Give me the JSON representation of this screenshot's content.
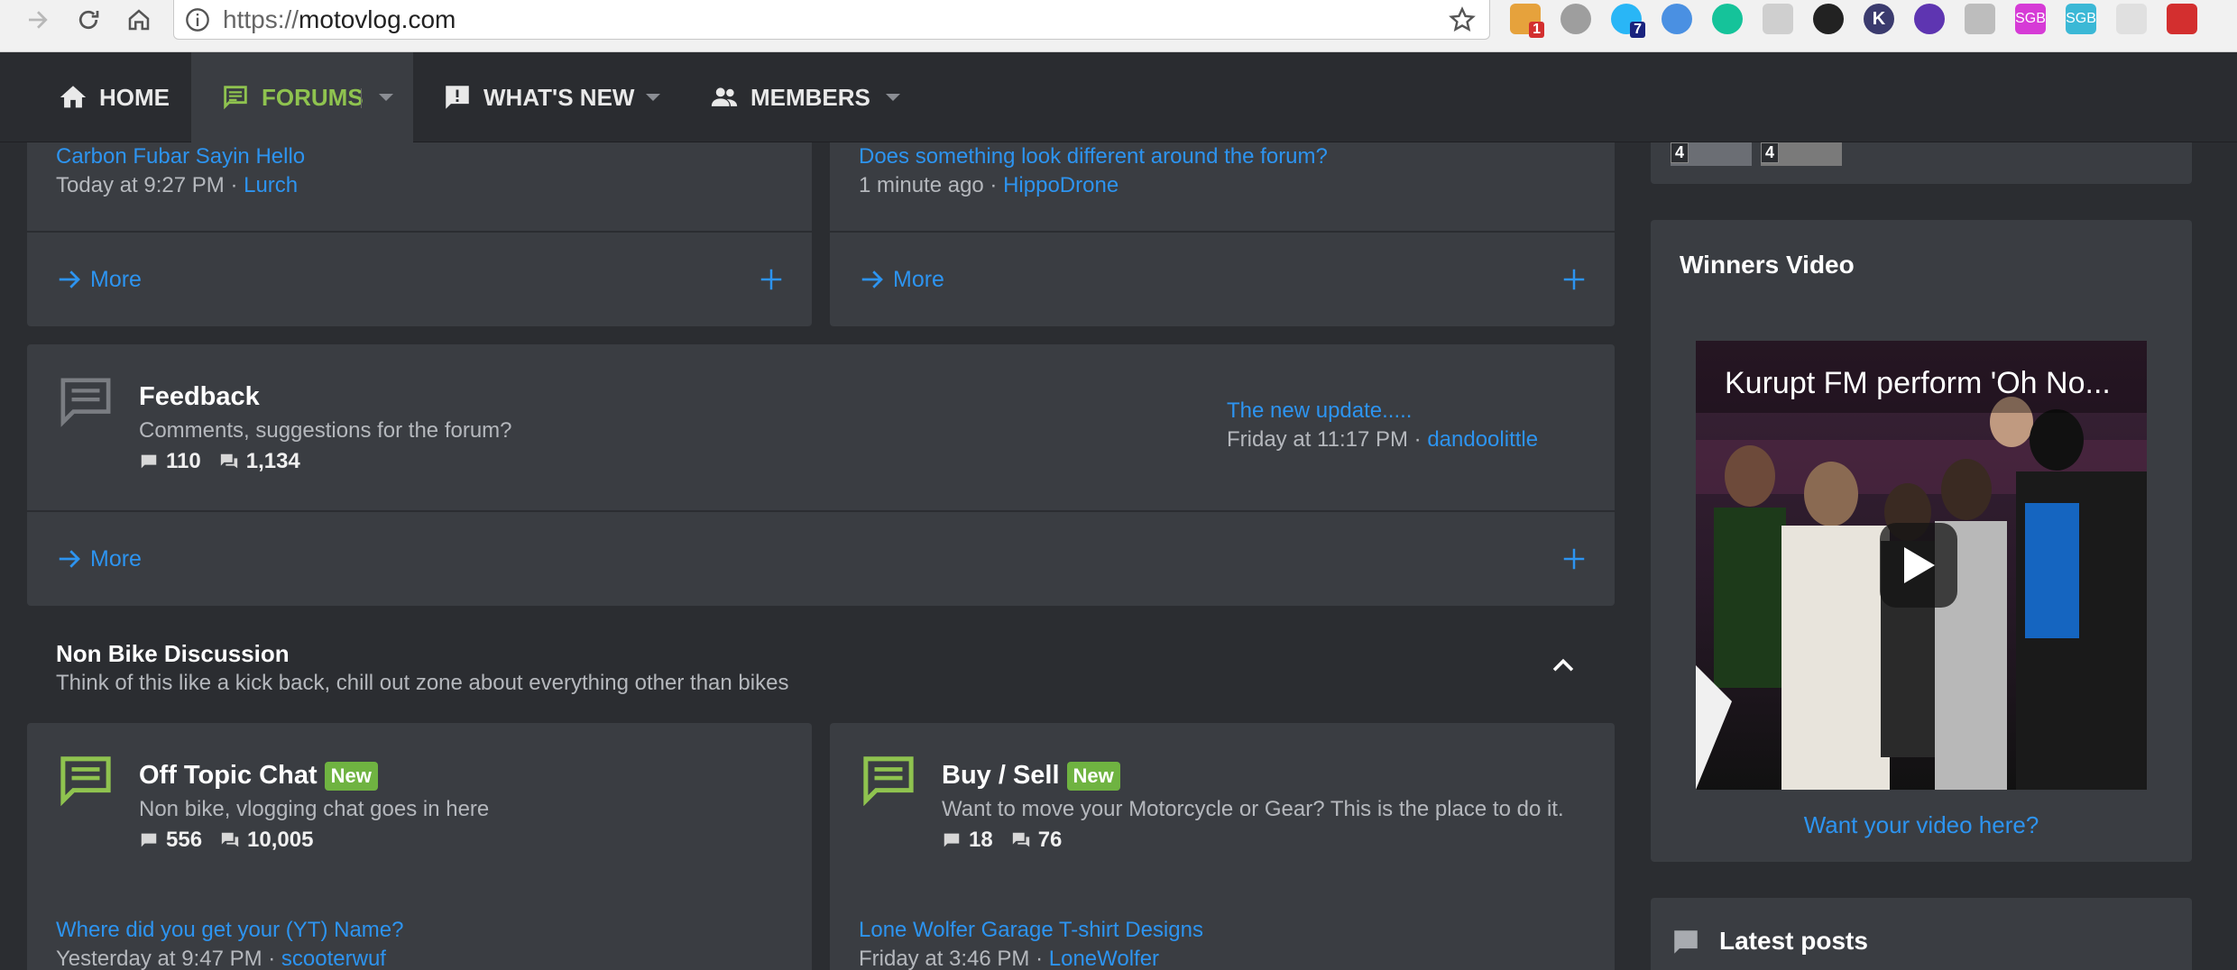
{
  "browser": {
    "url_scheme": "https://",
    "url_host": "motovlog.com"
  },
  "extensions": {
    "badge_1": "1",
    "badge_2": "7",
    "k_letter": "K",
    "sgb_1": "SGB",
    "sgb_2": "SGB"
  },
  "nav": {
    "home": "HOME",
    "forums": "FORUMS",
    "whats_new": "WHAT'S NEW",
    "members": "MEMBERS"
  },
  "colors": {
    "accent_green": "#8fc34f",
    "link_blue": "#2d94f0",
    "badge_green": "#6fb341",
    "panel_bg": "#3a3d42",
    "page_bg": "#2b2d31"
  },
  "top_left_card": {
    "thread": "Carbon Fubar Sayin Hello",
    "time": "Today at 9:27 PM",
    "user": "Lurch",
    "more": "More"
  },
  "top_right_card": {
    "thread": "Does something look different around the forum?",
    "time": "1 minute ago",
    "user": "HippoDrone",
    "more": "More"
  },
  "feedback": {
    "title": "Feedback",
    "desc": "Comments, suggestions for the forum?",
    "threads": "110",
    "messages": "1,134",
    "last_thread": "The new update.....",
    "last_time": "Friday at 11:17 PM",
    "last_user": "dandoolittle",
    "more": "More"
  },
  "non_bike": {
    "title": "Non Bike Discussion",
    "desc": "Think of this like a kick back, chill out zone about everything other than bikes"
  },
  "off_topic": {
    "title": "Off Topic Chat",
    "badge": "New",
    "desc": "Non bike, vlogging chat goes in here",
    "threads": "556",
    "messages": "10,005",
    "last_thread": "Where did you get your (YT) Name?",
    "last_time": "Yesterday at 9:47 PM",
    "last_user": "scooterwuf"
  },
  "buy_sell": {
    "title": "Buy / Sell",
    "badge": "New",
    "desc": "Want to move your Motorcycle or Gear? This is the place to do it.",
    "threads": "18",
    "messages": "76",
    "last_thread": "Lone Wolfer Garage T-shirt Designs",
    "last_time": "Friday at 3:46 PM",
    "last_user": "LoneWolfer"
  },
  "sidebar": {
    "avatar_count_1": "4",
    "avatar_count_2": "4",
    "winners_title": "Winners Video",
    "video_title": "Kurupt FM perform 'Oh No...",
    "video_cta": "Want your video here?",
    "latest_posts": "Latest posts"
  }
}
